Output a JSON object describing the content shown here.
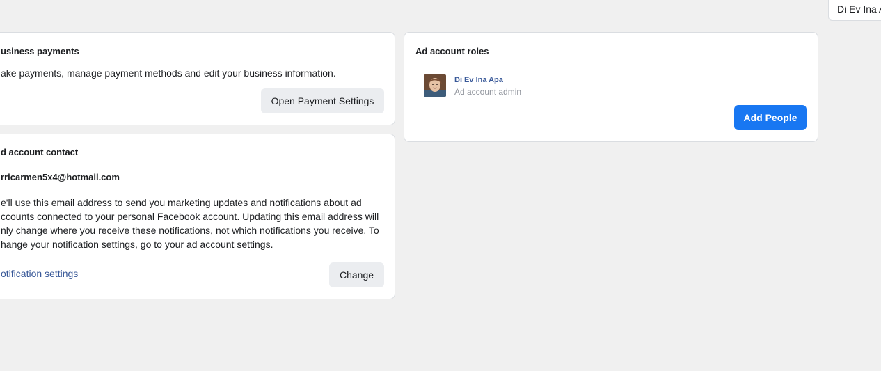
{
  "header": {
    "account_chip_label": "Di Ev Ina A"
  },
  "payments_card": {
    "title": "usiness payments",
    "description": "ake payments, manage payment methods and edit your business information.",
    "button_label": "Open Payment Settings"
  },
  "contact_card": {
    "title": "d account contact",
    "email": "rricarmen5x4@hotmail.com",
    "description_lines": [
      "e'll use this email address to send you marketing updates and notifications about ad",
      "ccounts connected to your personal Facebook account. Updating this email address will",
      "nly change where you receive these notifications, not which notifications you receive. To",
      "hange your notification settings, go to your ad account settings."
    ],
    "link_label": "otification settings",
    "button_label": "Change"
  },
  "roles_card": {
    "title": "Ad account roles",
    "person": {
      "name": "Di Ev Ina Apa",
      "role": "Ad account admin",
      "avatar_icon": "user-photo"
    },
    "button_label": "Add People"
  },
  "colors": {
    "background": "#f0f0f0",
    "card": "#ffffff",
    "border": "#dadde1",
    "primary": "#1877f2",
    "link": "#385898",
    "secondary_button": "#ebedf0",
    "muted_text": "#90949c"
  }
}
